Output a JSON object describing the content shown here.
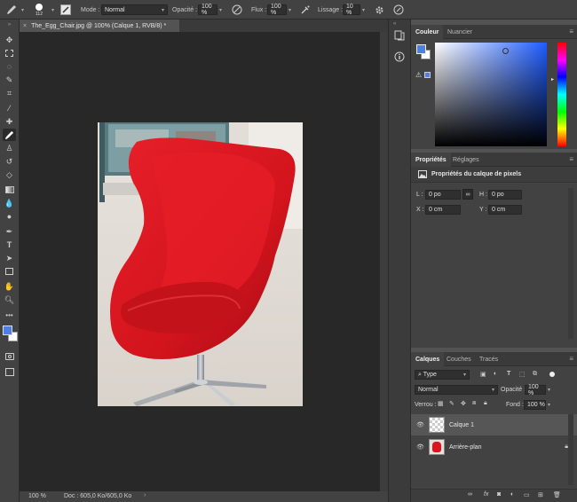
{
  "options": {
    "brush_size": "112",
    "mode_label": "Mode :",
    "mode_value": "Normal",
    "opacity_label": "Opacité :",
    "opacity_value": "100 %",
    "flow_label": "Flux :",
    "flow_value": "100 %",
    "smoothing_label": "Lissage :",
    "smoothing_value": "10 %"
  },
  "document": {
    "tab_title": "The_Egg_Chair.jpg @ 100% (Calque 1, RVB/8) *"
  },
  "status": {
    "zoom": "100 %",
    "doc_info": "Doc : 605,0 Ko/605,0 Ko"
  },
  "color_panel": {
    "tabs": [
      "Couleur",
      "Nuancier"
    ],
    "foreground": "#4f7fe0",
    "background": "#ffffff"
  },
  "properties_panel": {
    "tabs": [
      "Propriétés",
      "Réglages"
    ],
    "title": "Propriétés du calque de pixels",
    "L_label": "L :",
    "L_value": "0 po",
    "H_label": "H :",
    "H_value": "0 po",
    "X_label": "X :",
    "X_value": "0 cm",
    "Y_label": "Y :",
    "Y_value": "0 cm"
  },
  "layers_panel": {
    "tabs": [
      "Calques",
      "Couches",
      "Tracés"
    ],
    "filter_value": "Type",
    "blend_value": "Normal",
    "opacity_label": "Opacité :",
    "opacity_value": "100 %",
    "lock_label": "Verrou :",
    "fill_label": "Fond :",
    "fill_value": "100 %",
    "layers": [
      {
        "name": "Calque 1"
      },
      {
        "name": "Arrière-plan"
      }
    ]
  },
  "colors": {
    "accent_blue": "#4f7fe0",
    "chair_red": "#d8161f"
  }
}
